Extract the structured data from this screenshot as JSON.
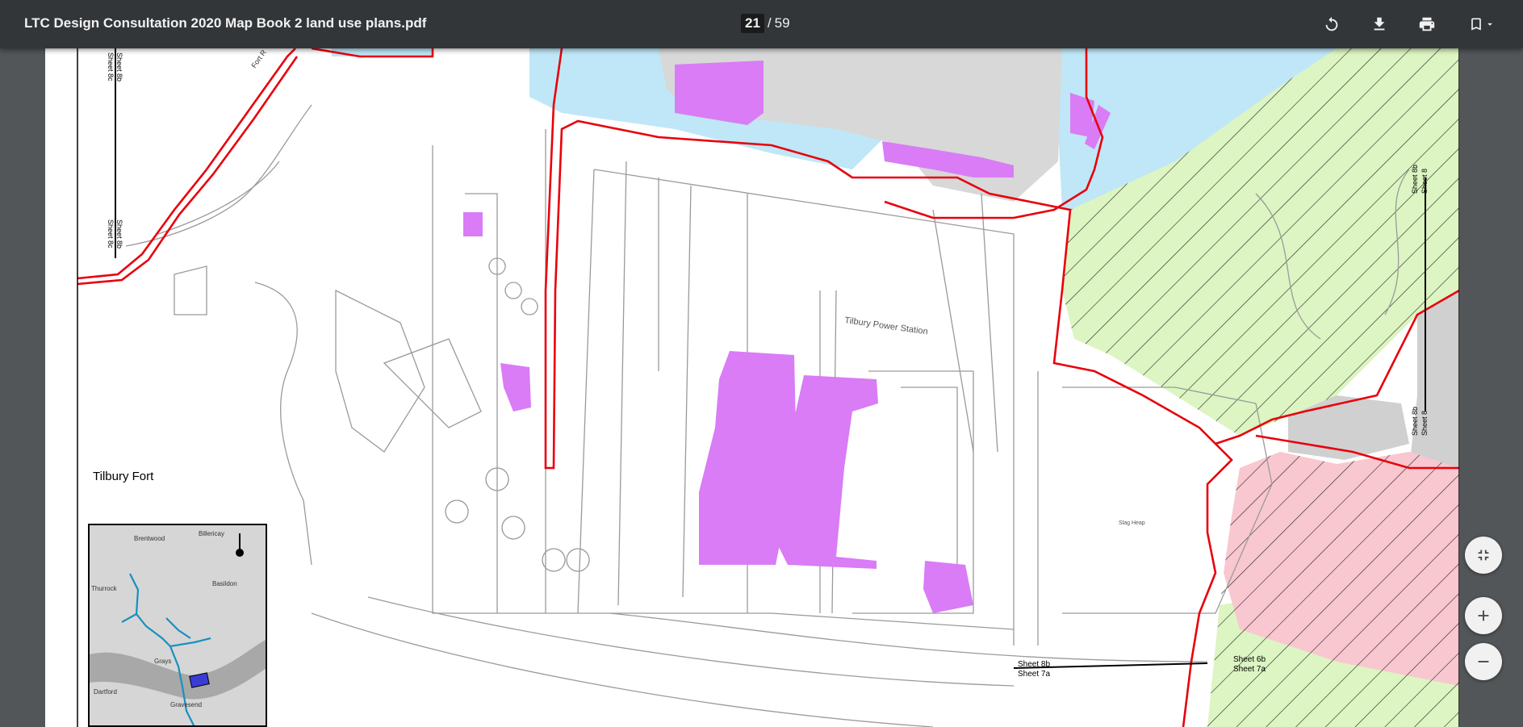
{
  "toolbar": {
    "title": "LTC Design Consultation 2020 Map Book 2 land use plans.pdf",
    "page_current": "21",
    "page_separator": "/",
    "page_total": "59",
    "icons": [
      "rotate-icon",
      "download-icon",
      "print-icon",
      "bookmark-icon",
      "chevron-down-icon"
    ]
  },
  "map": {
    "fort_label": "Tilbury  Fort",
    "power_station_label": "Tilbury Power Station",
    "slag_heap_label": "Slag Heap",
    "fort_road_label": "Fort R",
    "sheet_labels": {
      "left_top": "Sheet 8b",
      "left_top2": "Sheet 8c",
      "left_mid": "Sheet 8b",
      "left_mid2": "Sheet 8c",
      "right_top": "Sheet 8b",
      "right_top2": "Sheet 8",
      "right_mid": "Sheet 8b",
      "right_mid2": "Sheet 8",
      "bottom_mid": "Sheet 8b",
      "bottom_mid2": "Sheet 7a",
      "bottom_right": "Sheet 6b",
      "bottom_right2": "Sheet 7a"
    },
    "inset_labels": [
      "Brentwood",
      "Billericay",
      "Basildon",
      "Grays",
      "Dartford",
      "Gravesend",
      "Thurrock"
    ],
    "colors": {
      "boundary": "#e8000b",
      "development": "#d97cf5",
      "water": "#bfe7f7",
      "green": "#dcf5c2",
      "pink": "#f9c7cf",
      "built": "#d3d3d3"
    }
  },
  "zoom_controls": {
    "fit": "fit-to-page-icon",
    "zoom_in": "zoom-in-icon",
    "zoom_out": "zoom-out-icon"
  }
}
